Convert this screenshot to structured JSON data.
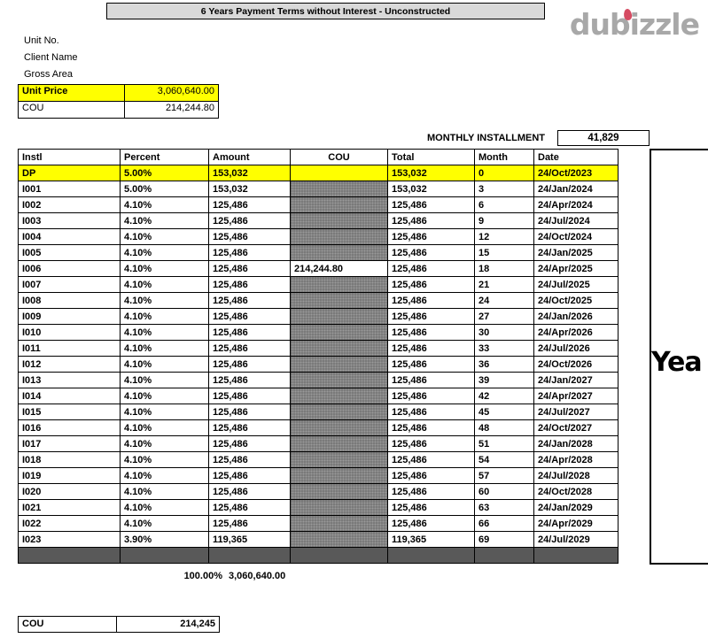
{
  "title": "6 Years  Payment Terms without Interest - Unconstructed",
  "watermark": "dubizzle",
  "info": {
    "unit_no_label": "Unit No.",
    "client_name_label": "Client Name",
    "gross_area_label": "Gross Area",
    "unit_price_label": "Unit Price",
    "unit_price_value": "3,060,640.00",
    "cou_label": "COU",
    "cou_value": "214,244.80"
  },
  "monthly_installment": {
    "label": "MONTHLY  INSTALLMENT",
    "value": "41,829"
  },
  "table": {
    "headers": [
      "Instl",
      "Percent",
      "Amount",
      "COU",
      "Total",
      "Month",
      "Date"
    ],
    "rows": [
      {
        "instl": "DP",
        "percent": "5.00%",
        "amount": "153,032",
        "cou": "",
        "total": "153,032",
        "month": "0",
        "date": "24/Oct/2023",
        "highlight": true,
        "hatched": true
      },
      {
        "instl": "I001",
        "percent": "5.00%",
        "amount": "153,032",
        "cou": "",
        "total": "153,032",
        "month": "3",
        "date": "24/Jan/2024",
        "highlight": false,
        "hatched": true
      },
      {
        "instl": "I002",
        "percent": "4.10%",
        "amount": "125,486",
        "cou": "",
        "total": "125,486",
        "month": "6",
        "date": "24/Apr/2024",
        "highlight": false,
        "hatched": true
      },
      {
        "instl": "I003",
        "percent": "4.10%",
        "amount": "125,486",
        "cou": "",
        "total": "125,486",
        "month": "9",
        "date": "24/Jul/2024",
        "highlight": false,
        "hatched": true
      },
      {
        "instl": "I004",
        "percent": "4.10%",
        "amount": "125,486",
        "cou": "",
        "total": "125,486",
        "month": "12",
        "date": "24/Oct/2024",
        "highlight": false,
        "hatched": true
      },
      {
        "instl": "I005",
        "percent": "4.10%",
        "amount": "125,486",
        "cou": "",
        "total": "125,486",
        "month": "15",
        "date": "24/Jan/2025",
        "highlight": false,
        "hatched": true
      },
      {
        "instl": "I006",
        "percent": "4.10%",
        "amount": "125,486",
        "cou": "214,244.80",
        "total": "125,486",
        "month": "18",
        "date": "24/Apr/2025",
        "highlight": false,
        "hatched": false
      },
      {
        "instl": "I007",
        "percent": "4.10%",
        "amount": "125,486",
        "cou": "",
        "total": "125,486",
        "month": "21",
        "date": "24/Jul/2025",
        "highlight": false,
        "hatched": true
      },
      {
        "instl": "I008",
        "percent": "4.10%",
        "amount": "125,486",
        "cou": "",
        "total": "125,486",
        "month": "24",
        "date": "24/Oct/2025",
        "highlight": false,
        "hatched": true
      },
      {
        "instl": "I009",
        "percent": "4.10%",
        "amount": "125,486",
        "cou": "",
        "total": "125,486",
        "month": "27",
        "date": "24/Jan/2026",
        "highlight": false,
        "hatched": true
      },
      {
        "instl": "I010",
        "percent": "4.10%",
        "amount": "125,486",
        "cou": "",
        "total": "125,486",
        "month": "30",
        "date": "24/Apr/2026",
        "highlight": false,
        "hatched": true
      },
      {
        "instl": "I011",
        "percent": "4.10%",
        "amount": "125,486",
        "cou": "",
        "total": "125,486",
        "month": "33",
        "date": "24/Jul/2026",
        "highlight": false,
        "hatched": true
      },
      {
        "instl": "I012",
        "percent": "4.10%",
        "amount": "125,486",
        "cou": "",
        "total": "125,486",
        "month": "36",
        "date": "24/Oct/2026",
        "highlight": false,
        "hatched": true
      },
      {
        "instl": "I013",
        "percent": "4.10%",
        "amount": "125,486",
        "cou": "",
        "total": "125,486",
        "month": "39",
        "date": "24/Jan/2027",
        "highlight": false,
        "hatched": true
      },
      {
        "instl": "I014",
        "percent": "4.10%",
        "amount": "125,486",
        "cou": "",
        "total": "125,486",
        "month": "42",
        "date": "24/Apr/2027",
        "highlight": false,
        "hatched": true
      },
      {
        "instl": "I015",
        "percent": "4.10%",
        "amount": "125,486",
        "cou": "",
        "total": "125,486",
        "month": "45",
        "date": "24/Jul/2027",
        "highlight": false,
        "hatched": true
      },
      {
        "instl": "I016",
        "percent": "4.10%",
        "amount": "125,486",
        "cou": "",
        "total": "125,486",
        "month": "48",
        "date": "24/Oct/2027",
        "highlight": false,
        "hatched": true
      },
      {
        "instl": "I017",
        "percent": "4.10%",
        "amount": "125,486",
        "cou": "",
        "total": "125,486",
        "month": "51",
        "date": "24/Jan/2028",
        "highlight": false,
        "hatched": true
      },
      {
        "instl": "I018",
        "percent": "4.10%",
        "amount": "125,486",
        "cou": "",
        "total": "125,486",
        "month": "54",
        "date": "24/Apr/2028",
        "highlight": false,
        "hatched": true
      },
      {
        "instl": "I019",
        "percent": "4.10%",
        "amount": "125,486",
        "cou": "",
        "total": "125,486",
        "month": "57",
        "date": "24/Jul/2028",
        "highlight": false,
        "hatched": true
      },
      {
        "instl": "I020",
        "percent": "4.10%",
        "amount": "125,486",
        "cou": "",
        "total": "125,486",
        "month": "60",
        "date": "24/Oct/2028",
        "highlight": false,
        "hatched": true
      },
      {
        "instl": "I021",
        "percent": "4.10%",
        "amount": "125,486",
        "cou": "",
        "total": "125,486",
        "month": "63",
        "date": "24/Jan/2029",
        "highlight": false,
        "hatched": true
      },
      {
        "instl": "I022",
        "percent": "4.10%",
        "amount": "125,486",
        "cou": "",
        "total": "125,486",
        "month": "66",
        "date": "24/Apr/2029",
        "highlight": false,
        "hatched": true
      },
      {
        "instl": "I023",
        "percent": "3.90%",
        "amount": "119,365",
        "cou": "",
        "total": "119,365",
        "month": "69",
        "date": "24/Jul/2029",
        "highlight": false,
        "hatched": true
      }
    ],
    "totals": {
      "percent": "100.00%",
      "amount": "3,060,640.00"
    }
  },
  "side_note": "Yea",
  "bottom": {
    "cou_label": "COU",
    "cou_value": "214,245"
  }
}
